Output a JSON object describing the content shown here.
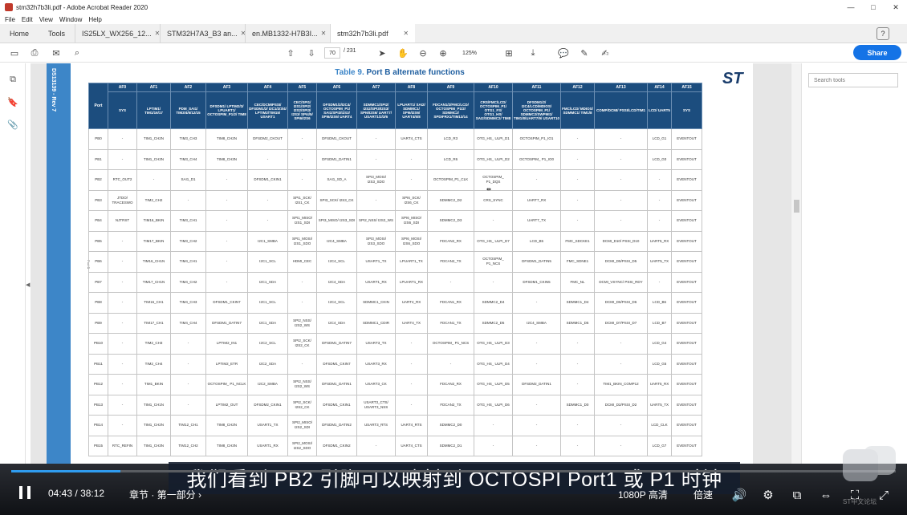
{
  "window": {
    "title": "stm32h7b3li.pdf - Adobe Acrobat Reader 2020",
    "menus": [
      "File",
      "Edit",
      "View",
      "Window",
      "Help"
    ],
    "controls": {
      "minimize": "—",
      "maximize": "□",
      "close": "✕"
    }
  },
  "tabs": {
    "home": "Home",
    "tools": "Tools",
    "docs": [
      {
        "label": "IS25LX_WX256_12...",
        "active": false
      },
      {
        "label": "STM32H7A3_B3 an...",
        "active": false
      },
      {
        "label": "en.MB1332-H7B3I...",
        "active": false
      },
      {
        "label": "stm32h7b3li.pdf",
        "active": true
      }
    ],
    "close_glyph": "✕",
    "help": "?"
  },
  "toolbar": {
    "page_current": "70",
    "page_total": "/ 231",
    "zoom": "125%",
    "share_label": "Share"
  },
  "right_panel": {
    "search_placeholder": "Search tools"
  },
  "document": {
    "side_label": "DS13139 - Rev 7",
    "table_title_prefix": "Table 9.",
    "table_title": "Port B alternate functions",
    "logo": "ST",
    "row_side_label": "Port B",
    "port_header": "Port",
    "af_headers": [
      "AF0",
      "AF1",
      "AF2",
      "AF3",
      "AF4",
      "AF5",
      "AF6",
      "AF7",
      "AF8",
      "AF9",
      "AF10",
      "AF11",
      "AF12",
      "AF13",
      "AF14",
      "AF15"
    ],
    "sub_headers": [
      "SYS",
      "LPTIM1/ TIM1/16/17",
      "PDM_SAI1/ TIM3/4/5/12/15",
      "DFSDM1/ LPTIM2/3/ LPUART1/ OCTOSPIM_P1/2/ TIM8",
      "CEC/DCMIPSSI/ DFSDM1/2/ I2C1/2/3/4/ LPTIM2/TIM15/ USART1",
      "CEC/SPI1/ I2S1/SPI2/ I2S2/SPI3/ I2S3/ SPI4/5/ SPI6/I2S6",
      "DFSDM1/2/I2C4/ OCTOSPIM_P1/ SAI1/SPI3/I2S3/ SPI6/I2S6/ UART4",
      "SDMMC1/SPI2/ I2S2/SPI3/I2S3/ SPI6/I2S6/ UART7/ USART1/2/3/6",
      "LPUART1/ SAI2/ SDMMC1/ SPI6/I2S6/ UART4/5/8",
      "FDCAN1/2/FMC/LCD/ OCTOSPIM_P1/2/ SDMMC2/ SPDIFRX1/TIM13/14",
      "CRS/FMC/LCD/ OCTOSPIM_P1/ OTG1_FS/ OTG1_HS/ SAI2/SDMMC2/ TIM8",
      "DFSDM1/2/ I2C4/LCD/MDIOS/ OCTOSPIM_P1/ SDMMC2/SWPMI1/ TIM1/8/UART7/9/ USART10",
      "FMC/LCD/ MDIOS/ SDMMC1/ TIM1/8",
      "COMP/DCMI/ PSSI/LCD/TIM1",
      "LCD/ UART5",
      "SYS"
    ],
    "rows": [
      [
        "PB0",
        "-",
        "TIM1_CH2N",
        "TIM3_CH3",
        "TIM8_CH2N",
        "DFSDM2_CKOUT",
        "-",
        "DFSDM1_CKOUT",
        "-",
        "UART4_CTS",
        "LCD_R3",
        "OTG_HS_ ULPI_D1",
        "OCTOSPIM_P1_IO1",
        "-",
        "-",
        "LCD_G1",
        "EVENTOUT"
      ],
      [
        "PB1",
        "-",
        "TIM1_CH3N",
        "TIM3_CH4",
        "TIM8_CH3N",
        "-",
        "-",
        "DFSDM1_DATIN1",
        "-",
        "-",
        "LCD_R6",
        "OTG_HS_ ULPI_D2",
        "OCTOSPIM_ P1_IO0",
        "-",
        "-",
        "LCD_G0",
        "EVENTOUT"
      ],
      [
        "PB2",
        "RTC_OUT2",
        "-",
        "SAI1_D1",
        "-",
        "DFSDM1_CKIN1",
        "-",
        "SAI1_SD_A",
        "SPI3_MOSI/ I2S3_SDO",
        "-",
        "OCTOSPIM_P1_CLK",
        "OCTOSPIM_ P1_DQS",
        "-",
        "-",
        "-",
        "-",
        "EVENTOUT"
      ],
      [
        "PB3",
        "JTDO/ TRACESWO",
        "TIM2_CH2",
        "-",
        "-",
        "-",
        "SPI1_SCK/ I2S1_CK",
        "SPI3_SCK/ I2S3_CK",
        "-",
        "SPI6_SCK/ I2S6_CK",
        "SDMMC2_D2",
        "CRS_SYNC",
        "UART7_RX",
        "-",
        "-",
        "-",
        "EVENTOUT"
      ],
      [
        "PB4",
        "NJTRST",
        "TIM16_BKIN",
        "TIM3_CH1",
        "-",
        "-",
        "SPI1_MISO/ I2S1_SDI",
        "SPI3_MISO/ I2S3_SDI",
        "SPI2_NSS/ I2S2_WS",
        "SPI6_MISO/ I2S6_SDI",
        "SDMMC2_D3",
        "-",
        "UART7_TX",
        "-",
        "-",
        "-",
        "EVENTOUT"
      ],
      [
        "PB5",
        "-",
        "TIM17_BKIN",
        "TIM3_CH2",
        "-",
        "I2C1_SMBA",
        "SPI1_MOSI/ I2S1_SDO",
        "I2C4_SMBA",
        "SPI3_MOSI/ I2S3_SDO",
        "SPI6_MOSI/ I2S6_SDO",
        "FDCAN2_RX",
        "OTG_HS_ ULPI_D7",
        "LCD_B5",
        "FMC_SDCKE1",
        "DCMI_D10/ PSSI_D10",
        "UART5_RX",
        "EVENTOUT"
      ],
      [
        "PB6",
        "-",
        "TIM16_CH1N",
        "TIM4_CH1",
        "-",
        "I2C1_SCL",
        "HDMI_CEC",
        "I2C4_SCL",
        "USART1_TX",
        "LPUART1_TX",
        "FDCAN2_TX",
        "OCTOSPIM_ P1_NCS",
        "DFSDM1_DATIN5",
        "FMC_SDNE1",
        "DCMI_D5/PSSI_D5",
        "UART5_TX",
        "EVENTOUT"
      ],
      [
        "PB7",
        "-",
        "TIM17_CH1N",
        "TIM4_CH2",
        "-",
        "I2C1_SDA",
        "-",
        "I2C4_SDA",
        "USART1_RX",
        "LPUART1_RX",
        "-",
        "-",
        "DFSDM1_CKIN5",
        "FMC_NL",
        "DCMI_VSYNC/ PSSI_RDY",
        "-",
        "EVENTOUT"
      ],
      [
        "PB8",
        "-",
        "TIM16_CH1",
        "TIM4_CH3",
        "DFSDM1_CKIN7",
        "I2C1_SCL",
        "-",
        "I2C4_SCL",
        "SDMMC1_CKIN",
        "UART4_RX",
        "FDCAN1_RX",
        "SDMMC2_D4",
        "-",
        "SDMMC1_D4",
        "DCMI_D6/PSSI_D6",
        "LCD_B6",
        "EVENTOUT"
      ],
      [
        "PB9",
        "-",
        "TIM17_CH1",
        "TIM4_CH4",
        "DFSDM1_DATIN7",
        "I2C1_SDA",
        "SPI2_NSS/ I2S2_WS",
        "I2C4_SDA",
        "SDMMC1_CDIR",
        "UART4_TX",
        "FDCAN1_TX",
        "SDMMC2_D5",
        "I2C4_SMBA",
        "SDMMC1_D5",
        "DCMI_D7/PSSI_D7",
        "LCD_B7",
        "EVENTOUT"
      ],
      [
        "PB10",
        "-",
        "TIM2_CH3",
        "-",
        "LPTIM2_IN1",
        "I2C2_SCL",
        "SPI2_SCK/ I2S2_CK",
        "DFSDM1_DATIN7",
        "USART3_TX",
        "-",
        "OCTOSPIM_ P1_NCS",
        "OTG_HS_ ULPI_D3",
        "-",
        "-",
        "-",
        "LCD_G4",
        "EVENTOUT"
      ],
      [
        "PB11",
        "-",
        "TIM2_CH4",
        "-",
        "LPTIM2_ETR",
        "I2C2_SDA",
        "-",
        "DFSDM1_CKIN7",
        "USART3_RX",
        "-",
        "-",
        "OTG_HS_ ULPI_D4",
        "-",
        "-",
        "-",
        "LCD_G5",
        "EVENTOUT"
      ],
      [
        "PB12",
        "-",
        "TIM1_BKIN",
        "-",
        "OCTOSPIM_ P1_NCLK",
        "I2C2_SMBA",
        "SPI2_NSS/ I2S2_WS",
        "DFSDM1_DATIN1",
        "USART3_CK",
        "-",
        "FDCAN2_RX",
        "OTG_HS_ ULPI_D5",
        "DFSDM2_DATIN1",
        "-",
        "TIM1_BKIN_COMP12",
        "UART5_RX",
        "EVENTOUT"
      ],
      [
        "PB13",
        "-",
        "TIM1_CH1N",
        "-",
        "LPTIM2_OUT",
        "DFSDM2_CKIN1",
        "SPI2_SCK/ I2S2_CK",
        "DFSDM1_CKIN1",
        "USART3_CTS/ USART3_NSS",
        "-",
        "FDCAN2_TX",
        "OTG_HS_ ULPI_D6",
        "-",
        "SDMMC1_D0",
        "DCMI_D2/PSSI_D2",
        "UART5_TX",
        "EVENTOUT"
      ],
      [
        "PB14",
        "-",
        "TIM1_CH2N",
        "TIM12_CH1",
        "TIM8_CH2N",
        "USART1_TX",
        "SPI2_MISO/ I2S2_SDI",
        "DFSDM1_DATIN2",
        "USART3_RTS",
        "UART4_RTS",
        "SDMMC2_D0",
        "-",
        "-",
        "-",
        "-",
        "LCD_CLK",
        "EVENTOUT"
      ],
      [
        "PB15",
        "RTC_REFIN",
        "TIM1_CH3N",
        "TIM12_CH2",
        "TIM8_CH3N",
        "USART1_RX",
        "SPI2_MOSI/ I2S2_SDO",
        "DFSDM1_CKIN2",
        "-",
        "UART4_CTS",
        "SDMMC2_D1",
        "-",
        "-",
        "-",
        "-",
        "LCD_G7",
        "EVENTOUT"
      ]
    ]
  },
  "player": {
    "subtitle": "我们看到 PB2 引脚可以映射到 OCTOSPI Port1 或 P1 时钟",
    "time_current": "04:43",
    "time_separator": "/",
    "time_total": "38:12",
    "chapter": "章节 · 第一部分 ›",
    "resolution": "1080P 高清",
    "speed": "倍速",
    "progress": 0.123,
    "watermark": "ST中文论坛"
  }
}
